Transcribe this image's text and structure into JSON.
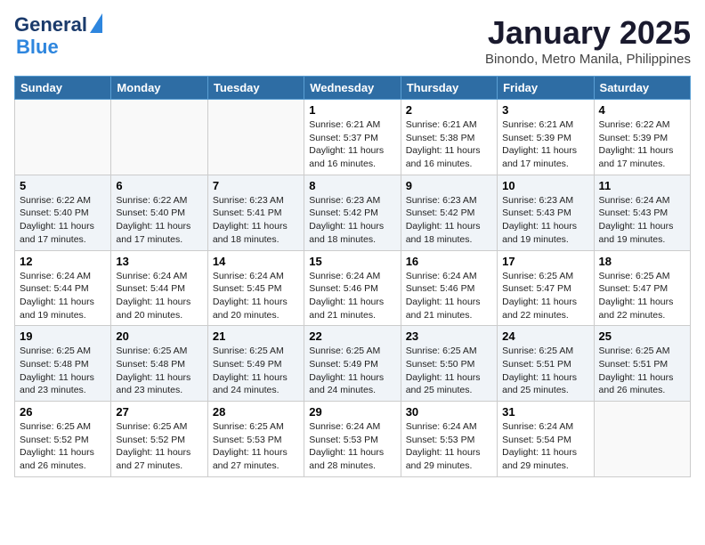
{
  "header": {
    "logo_line1": "General",
    "logo_line2": "Blue",
    "month": "January 2025",
    "location": "Binondo, Metro Manila, Philippines"
  },
  "days_of_week": [
    "Sunday",
    "Monday",
    "Tuesday",
    "Wednesday",
    "Thursday",
    "Friday",
    "Saturday"
  ],
  "weeks": [
    [
      {
        "day": "",
        "sunrise": "",
        "sunset": "",
        "daylight": ""
      },
      {
        "day": "",
        "sunrise": "",
        "sunset": "",
        "daylight": ""
      },
      {
        "day": "",
        "sunrise": "",
        "sunset": "",
        "daylight": ""
      },
      {
        "day": "1",
        "sunrise": "6:21 AM",
        "sunset": "5:37 PM",
        "daylight": "11 hours and 16 minutes."
      },
      {
        "day": "2",
        "sunrise": "6:21 AM",
        "sunset": "5:38 PM",
        "daylight": "11 hours and 16 minutes."
      },
      {
        "day": "3",
        "sunrise": "6:21 AM",
        "sunset": "5:39 PM",
        "daylight": "11 hours and 17 minutes."
      },
      {
        "day": "4",
        "sunrise": "6:22 AM",
        "sunset": "5:39 PM",
        "daylight": "11 hours and 17 minutes."
      }
    ],
    [
      {
        "day": "5",
        "sunrise": "6:22 AM",
        "sunset": "5:40 PM",
        "daylight": "11 hours and 17 minutes."
      },
      {
        "day": "6",
        "sunrise": "6:22 AM",
        "sunset": "5:40 PM",
        "daylight": "11 hours and 17 minutes."
      },
      {
        "day": "7",
        "sunrise": "6:23 AM",
        "sunset": "5:41 PM",
        "daylight": "11 hours and 18 minutes."
      },
      {
        "day": "8",
        "sunrise": "6:23 AM",
        "sunset": "5:42 PM",
        "daylight": "11 hours and 18 minutes."
      },
      {
        "day": "9",
        "sunrise": "6:23 AM",
        "sunset": "5:42 PM",
        "daylight": "11 hours and 18 minutes."
      },
      {
        "day": "10",
        "sunrise": "6:23 AM",
        "sunset": "5:43 PM",
        "daylight": "11 hours and 19 minutes."
      },
      {
        "day": "11",
        "sunrise": "6:24 AM",
        "sunset": "5:43 PM",
        "daylight": "11 hours and 19 minutes."
      }
    ],
    [
      {
        "day": "12",
        "sunrise": "6:24 AM",
        "sunset": "5:44 PM",
        "daylight": "11 hours and 19 minutes."
      },
      {
        "day": "13",
        "sunrise": "6:24 AM",
        "sunset": "5:44 PM",
        "daylight": "11 hours and 20 minutes."
      },
      {
        "day": "14",
        "sunrise": "6:24 AM",
        "sunset": "5:45 PM",
        "daylight": "11 hours and 20 minutes."
      },
      {
        "day": "15",
        "sunrise": "6:24 AM",
        "sunset": "5:46 PM",
        "daylight": "11 hours and 21 minutes."
      },
      {
        "day": "16",
        "sunrise": "6:24 AM",
        "sunset": "5:46 PM",
        "daylight": "11 hours and 21 minutes."
      },
      {
        "day": "17",
        "sunrise": "6:25 AM",
        "sunset": "5:47 PM",
        "daylight": "11 hours and 22 minutes."
      },
      {
        "day": "18",
        "sunrise": "6:25 AM",
        "sunset": "5:47 PM",
        "daylight": "11 hours and 22 minutes."
      }
    ],
    [
      {
        "day": "19",
        "sunrise": "6:25 AM",
        "sunset": "5:48 PM",
        "daylight": "11 hours and 23 minutes."
      },
      {
        "day": "20",
        "sunrise": "6:25 AM",
        "sunset": "5:48 PM",
        "daylight": "11 hours and 23 minutes."
      },
      {
        "day": "21",
        "sunrise": "6:25 AM",
        "sunset": "5:49 PM",
        "daylight": "11 hours and 24 minutes."
      },
      {
        "day": "22",
        "sunrise": "6:25 AM",
        "sunset": "5:49 PM",
        "daylight": "11 hours and 24 minutes."
      },
      {
        "day": "23",
        "sunrise": "6:25 AM",
        "sunset": "5:50 PM",
        "daylight": "11 hours and 25 minutes."
      },
      {
        "day": "24",
        "sunrise": "6:25 AM",
        "sunset": "5:51 PM",
        "daylight": "11 hours and 25 minutes."
      },
      {
        "day": "25",
        "sunrise": "6:25 AM",
        "sunset": "5:51 PM",
        "daylight": "11 hours and 26 minutes."
      }
    ],
    [
      {
        "day": "26",
        "sunrise": "6:25 AM",
        "sunset": "5:52 PM",
        "daylight": "11 hours and 26 minutes."
      },
      {
        "day": "27",
        "sunrise": "6:25 AM",
        "sunset": "5:52 PM",
        "daylight": "11 hours and 27 minutes."
      },
      {
        "day": "28",
        "sunrise": "6:25 AM",
        "sunset": "5:53 PM",
        "daylight": "11 hours and 27 minutes."
      },
      {
        "day": "29",
        "sunrise": "6:24 AM",
        "sunset": "5:53 PM",
        "daylight": "11 hours and 28 minutes."
      },
      {
        "day": "30",
        "sunrise": "6:24 AM",
        "sunset": "5:53 PM",
        "daylight": "11 hours and 29 minutes."
      },
      {
        "day": "31",
        "sunrise": "6:24 AM",
        "sunset": "5:54 PM",
        "daylight": "11 hours and 29 minutes."
      },
      {
        "day": "",
        "sunrise": "",
        "sunset": "",
        "daylight": ""
      }
    ]
  ],
  "labels": {
    "sunrise": "Sunrise:",
    "sunset": "Sunset:",
    "daylight": "Daylight:"
  }
}
